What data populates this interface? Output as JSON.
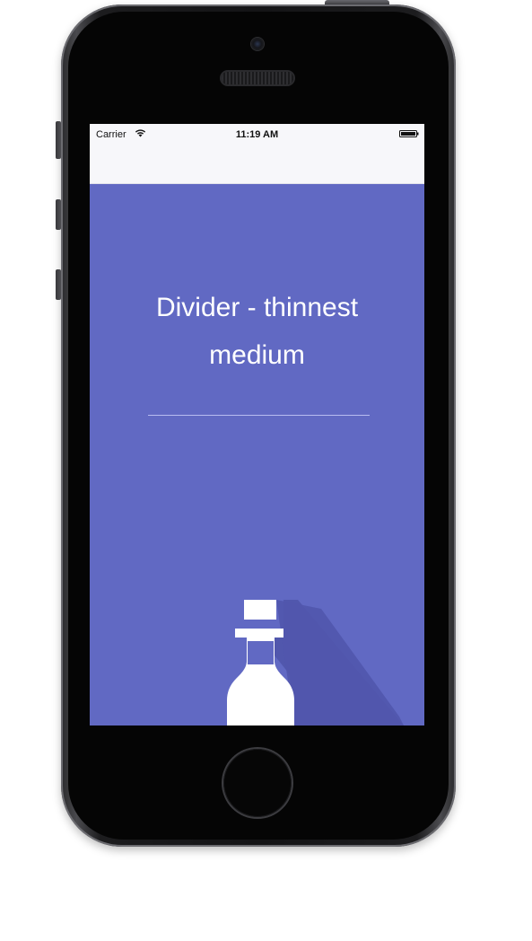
{
  "status_bar": {
    "carrier": "Carrier",
    "time": "11:19 AM",
    "wifi_icon": "wifi-icon",
    "battery_icon": "battery-icon"
  },
  "content": {
    "title_line1": "Divider - thinnest",
    "title_line2": "medium",
    "illustration_icon": "bottle-icon"
  },
  "colors": {
    "background": "#6169c3",
    "shadow": "#5157ad",
    "text": "#ffffff",
    "divider": "#b8bdf0",
    "status_bar": "#f7f7fa"
  }
}
